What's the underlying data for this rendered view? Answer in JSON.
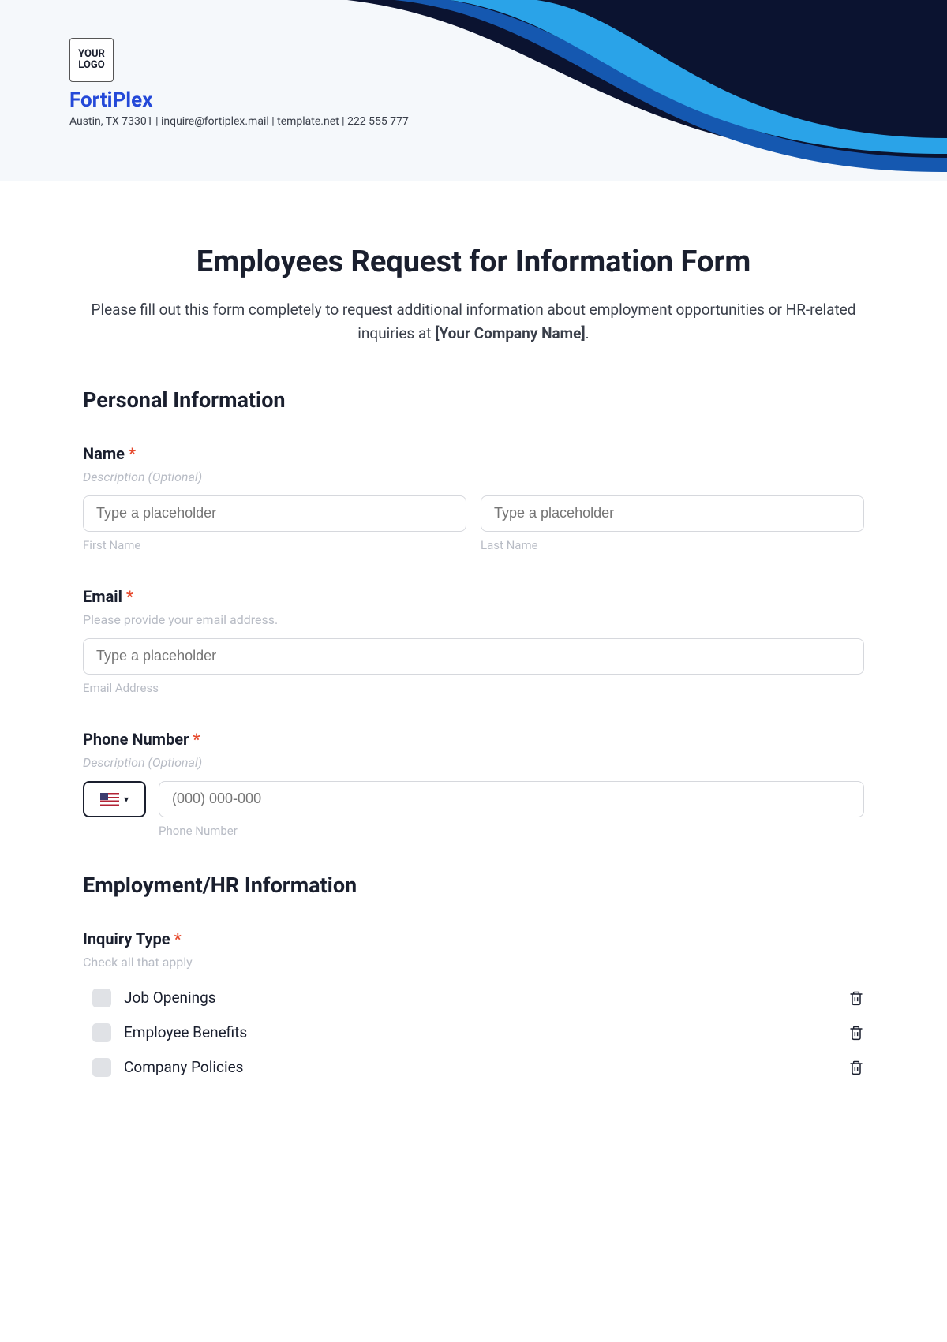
{
  "header": {
    "logo_text": "YOUR LOGO",
    "company_name": "FortiPlex",
    "company_meta": "Austin, TX 73301 | inquire@fortiplex.mail | template.net | 222 555 777"
  },
  "form": {
    "title": "Employees Request for Information Form",
    "intro_pre": "Please fill out this form completely to request additional information about employment opportunities or HR-related inquiries at ",
    "intro_bold": "[Your Company Name]",
    "intro_post": ".",
    "section_personal": "Personal Information",
    "name": {
      "label": "Name",
      "desc": "Description (Optional)",
      "first_placeholder": "Type a placeholder",
      "last_placeholder": "Type a placeholder",
      "first_sub": "First Name",
      "last_sub": "Last Name"
    },
    "email": {
      "label": "Email",
      "desc": "Please provide your email address.",
      "placeholder": "Type a placeholder",
      "sub": "Email Address"
    },
    "phone": {
      "label": "Phone Number",
      "desc": "Description (Optional)",
      "placeholder": "(000) 000-000",
      "sub": "Phone Number"
    },
    "section_hr": "Employment/HR Information",
    "inquiry": {
      "label": "Inquiry Type",
      "desc": "Check all that apply",
      "options": [
        "Job Openings",
        "Employee Benefits",
        "Company Policies"
      ]
    },
    "required_marker": "*"
  }
}
